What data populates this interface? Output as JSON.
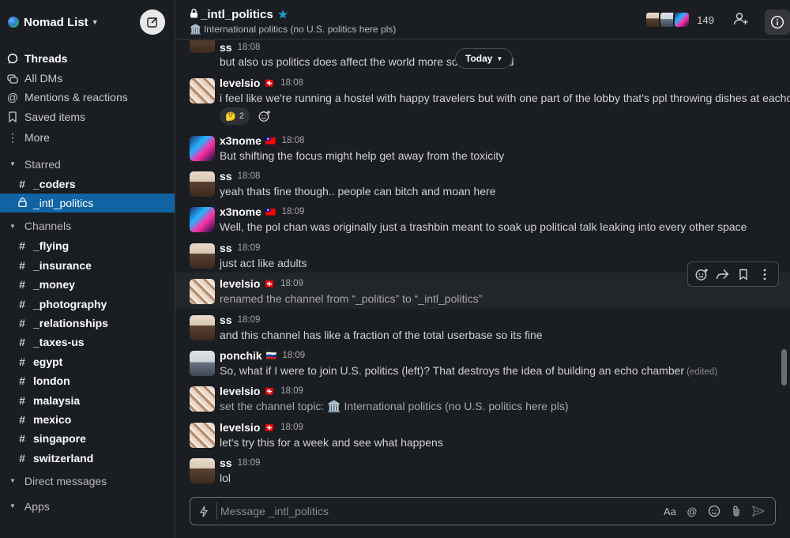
{
  "workspace": {
    "name": "Nomad List"
  },
  "nav": {
    "threads": "Threads",
    "all_dms": "All DMs",
    "mentions": "Mentions & reactions",
    "saved": "Saved items",
    "more": "More"
  },
  "sections": {
    "starred": "Starred",
    "channels": "Channels",
    "direct_messages": "Direct messages",
    "apps": "Apps"
  },
  "starred_channels": [
    "_coders",
    "_intl_politics"
  ],
  "channels": [
    "_flying",
    "_insurance",
    "_money",
    "_photography",
    "_relationships",
    "_taxes-us",
    "egypt",
    "london",
    "malaysia",
    "mexico",
    "singapore",
    "switzerland"
  ],
  "header": {
    "channel_name": "_intl_politics",
    "topic": "International politics (no U.S. politics here pls)",
    "member_count": "149"
  },
  "today_label": "Today",
  "messages": [
    {
      "user": "ss",
      "flag": "",
      "time": "18:08",
      "text": "but also us politics does affect the world more so the                    around"
    },
    {
      "user": "levelsio",
      "flag": "🇨🇭",
      "time": "18:08",
      "text": "i feel like we're running a hostel with happy travelers but with one part of the lobby that's ppl throwing dishes at eachother",
      "reaction_emoji": "🤔",
      "reaction_count": "2"
    },
    {
      "user": "x3nome",
      "flag": "🇹🇼",
      "time": "18:08",
      "text": "But shifting the focus might help get away from the toxicity"
    },
    {
      "user": "ss",
      "flag": "",
      "time": "18:08",
      "text": "yeah thats fine though.. people can bitch and moan here"
    },
    {
      "user": "x3nome",
      "flag": "🇹🇼",
      "time": "18:09",
      "text": "Well, the pol chan was originally just a trashbin meant to soak up political talk leaking into every other space"
    },
    {
      "user": "ss",
      "flag": "",
      "time": "18:09",
      "text": "just act like adults"
    },
    {
      "user": "levelsio",
      "flag": "🇨🇭",
      "time": "18:09",
      "text": "renamed the channel from “_politics” to “_intl_politics”"
    },
    {
      "user": "ss",
      "flag": "",
      "time": "18:09",
      "text": "and this channel has like a fraction of the total userbase so its fine"
    },
    {
      "user": "ponchik",
      "flag": "🇷🇺",
      "time": "18:09",
      "text": "So, what if I were to join U.S. politics (left)? That destroys the idea of building an echo chamber",
      "edited": "(edited)"
    },
    {
      "user": "levelsio",
      "flag": "🇨🇭",
      "time": "18:09",
      "text": "set the channel topic: 🏛️ International politics (no U.S. politics here pls)"
    },
    {
      "user": "levelsio",
      "flag": "🇨🇭",
      "time": "18:09",
      "text": "let's try this for a week and see what happens"
    },
    {
      "user": "ss",
      "flag": "",
      "time": "18:09",
      "text": "lol"
    }
  ],
  "composer": {
    "placeholder": "Message _intl_politics",
    "format_label": "Aa"
  }
}
